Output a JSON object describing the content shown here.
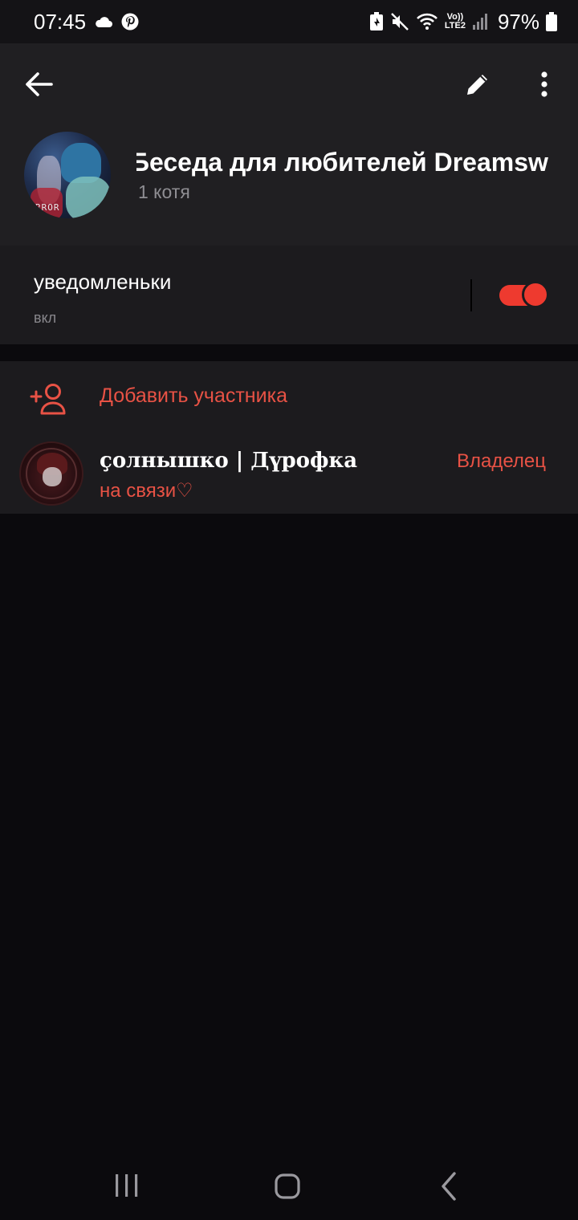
{
  "status_bar": {
    "time": "07:45",
    "battery_percent": "97%",
    "network_label_top": "Vo))",
    "network_label_bottom": "LTE2",
    "icons": [
      "cloud-icon",
      "pinterest-icon",
      "battery-saver-icon",
      "mute-icon",
      "wifi-icon",
      "signal-icon",
      "battery-icon"
    ]
  },
  "header": {
    "title": "Беседа для любителей Dreamsw",
    "subtitle": "1 котя",
    "avatar_text": "RROR"
  },
  "notifications": {
    "label": "уведомленьки",
    "state": "вкл",
    "enabled": true,
    "accent_color": "#ee3a2f"
  },
  "members": {
    "add_label": "Добавить участника",
    "list": [
      {
        "name": "ҫолнышко | Дүрофка",
        "status": "на связи♡",
        "role": "Владелец"
      }
    ]
  },
  "colors": {
    "background": "#0b0a0d",
    "header_bg": "#201f22",
    "card_bg": "#1c1b1e",
    "accent": "#e85245"
  }
}
